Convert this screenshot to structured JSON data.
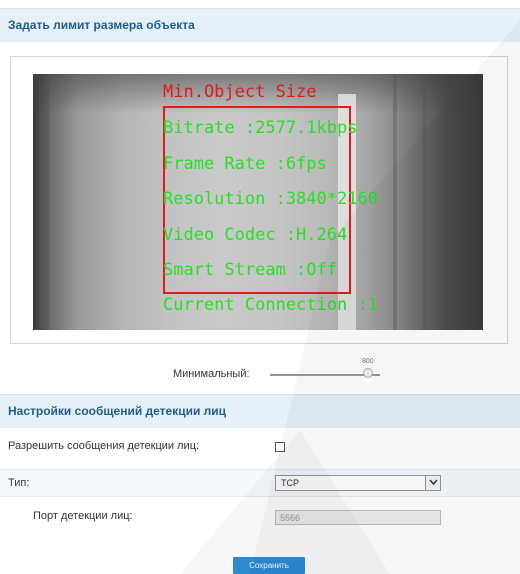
{
  "sections": {
    "object_size": {
      "title": "Задать лимит размера объекта"
    },
    "face_messages": {
      "title": "Настройки сообщений детекции лиц"
    }
  },
  "video": {
    "overlay": {
      "roi_label": "Min.Object Size",
      "lines": [
        "Bitrate :2577.1kbps",
        "Frame Rate :6fps",
        "Resolution :3840*2160",
        "Video Codec :H.264",
        "Smart Stream :Off",
        "Current Connection :1"
      ]
    }
  },
  "slider": {
    "label": "Минимальный:",
    "value": "800"
  },
  "form": {
    "enable_label": "Разрешить сообщения детекции лиц:",
    "enable_checked": false,
    "type_label": "Тип:",
    "type_value": "TCP",
    "port_label": "Порт детекции лиц:",
    "port_value": "5566"
  },
  "save_label": "Сохранить",
  "colors": {
    "header_bg": "#e5f0f8",
    "header_text": "#1f5d8e",
    "osd_green": "#27e127",
    "osd_red": "#e01b1b",
    "button_blue": "#2f8fd8"
  }
}
